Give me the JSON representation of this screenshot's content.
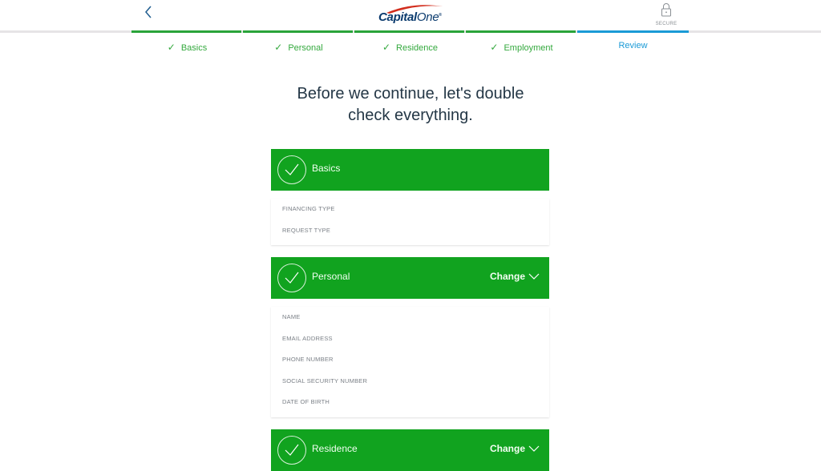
{
  "header": {
    "back_icon": "chevron-left-icon",
    "logo": {
      "text_bold": "Capital",
      "text_light": "One",
      "trademark": "®"
    },
    "secure": {
      "icon": "lock-icon",
      "label": "SECURE"
    }
  },
  "progress": {
    "steps": [
      {
        "label": "Basics",
        "status": "complete",
        "check": "✓"
      },
      {
        "label": "Personal",
        "status": "complete",
        "check": "✓"
      },
      {
        "label": "Residence",
        "status": "complete",
        "check": "✓"
      },
      {
        "label": "Employment",
        "status": "complete",
        "check": "✓"
      },
      {
        "label": "Review",
        "status": "active"
      }
    ],
    "colors": {
      "complete": "#2aa43a",
      "active": "#1a9ad6",
      "track": "#e6e4e6"
    }
  },
  "headline": {
    "line1": "Before we continue, let's double",
    "line2": "check everything."
  },
  "sections": [
    {
      "title": "Basics",
      "change_label": null,
      "fields": [
        "FINANCING TYPE",
        "REQUEST TYPE"
      ]
    },
    {
      "title": "Personal",
      "change_label": "Change",
      "fields": [
        "NAME",
        "EMAIL ADDRESS",
        "PHONE NUMBER",
        "SOCIAL SECURITY NUMBER",
        "DATE OF BIRTH"
      ]
    },
    {
      "title": "Residence",
      "change_label": "Change",
      "fields": []
    }
  ],
  "colors": {
    "section_header": "#11a31f",
    "headline": "#243746"
  }
}
